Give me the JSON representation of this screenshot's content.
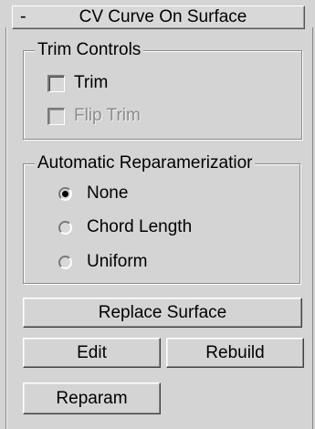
{
  "rollout": {
    "toggle_symbol": "-",
    "title": "CV Curve On Surface"
  },
  "trim_controls": {
    "legend": "Trim Controls",
    "trim": {
      "label": "Trim",
      "checked": false,
      "enabled": true
    },
    "flip_trim": {
      "label": "Flip Trim",
      "checked": false,
      "enabled": false
    }
  },
  "reparameterization": {
    "legend": "Automatic Reparamerizatior",
    "options": [
      {
        "label": "None",
        "selected": true
      },
      {
        "label": "Chord Length",
        "selected": false
      },
      {
        "label": "Uniform",
        "selected": false
      }
    ]
  },
  "buttons": {
    "replace_surface": "Replace Surface",
    "edit": "Edit",
    "rebuild": "Rebuild",
    "reparam": "Reparam"
  }
}
